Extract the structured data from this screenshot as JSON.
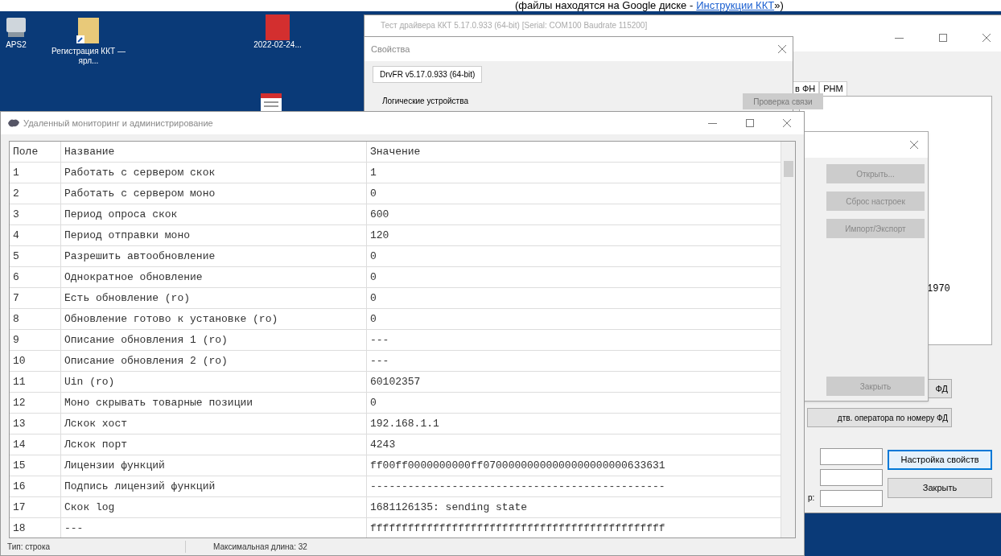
{
  "top_note": {
    "text": "(файлы находятся на Google диске -",
    "link": "Инструкции ККТ",
    "tail": "»)"
  },
  "desktop_icons": [
    {
      "kind": "drive",
      "label": "APS2"
    },
    {
      "kind": "folder",
      "label": "Регистрация ККТ — ярл..."
    },
    {
      "kind": "pdf",
      "label": "2022-02-24..."
    },
    {
      "kind": "doc"
    }
  ],
  "driver_window": {
    "title": "Тест драйвера ККТ 5.17.0.933 (64-bit) [Serial: COM100 Baudrate 115200]",
    "tabs": [
      "в ФН",
      "РНМ"
    ],
    "output_text": "1970",
    "buttons": [
      {
        "label": "ФД"
      },
      {
        "label": "дтв. оператора по номеру ФД"
      }
    ],
    "field_label": "р:",
    "actions": [
      {
        "label": "Настройка свойств",
        "selected": true
      },
      {
        "label": "Закрыть",
        "selected": false
      }
    ]
  },
  "properties_dialog": {
    "title": "Свойства",
    "tab": "DrvFR v5.17.0.933 (64-bit)",
    "group": "Логические устройства",
    "button": "Проверка связи"
  },
  "side_dialog": {
    "buttons": [
      {
        "label": "Открыть...",
        "disabled": true
      },
      {
        "label": "Сброс настроек",
        "disabled": true
      },
      {
        "label": "Импорт/Экспорт",
        "disabled": true
      }
    ],
    "close": {
      "label": "Закрыть",
      "disabled": true
    }
  },
  "main_window": {
    "title": "Удаленный мониторинг и администрирование",
    "table": {
      "columns": [
        "Поле",
        "Название",
        "Значение"
      ],
      "rows": [
        [
          "1",
          "Работать с сервером скок",
          "1"
        ],
        [
          "2",
          "Работать с сервером моно",
          "0"
        ],
        [
          "3",
          "Период опроса скок",
          "600"
        ],
        [
          "4",
          "Период отправки моно",
          "120"
        ],
        [
          "5",
          "Разрешить автообновление",
          "0"
        ],
        [
          "6",
          "Однократное обновление",
          "0"
        ],
        [
          "7",
          "Есть обновление (ro)",
          "0"
        ],
        [
          "8",
          "Обновление готово к установке (ro)",
          "0"
        ],
        [
          "9",
          "Описание обновления 1 (ro)",
          "---"
        ],
        [
          "10",
          "Описание обновления 2 (ro)",
          "---"
        ],
        [
          "11",
          "Uin (ro)",
          "60102357"
        ],
        [
          "12",
          "Моно скрывать товарные позиции",
          "0"
        ],
        [
          "13",
          "Лскок хост",
          "192.168.1.1"
        ],
        [
          "14",
          "Лскок порт",
          "4243"
        ],
        [
          "15",
          "Лицензии функций",
          "ff00ff0000000000ff07000000000000000000000633631"
        ],
        [
          "16",
          "Подпись лицензий функций",
          "-----------------------------------------------"
        ],
        [
          "17",
          "Скок log",
          "1681126135: sending state"
        ],
        [
          "18",
          "---",
          "fffffffffffffffffffffffffffffffffffffffffffffff"
        ]
      ]
    },
    "status": [
      "Тип: строка",
      "Максимальная длина: 32"
    ]
  }
}
